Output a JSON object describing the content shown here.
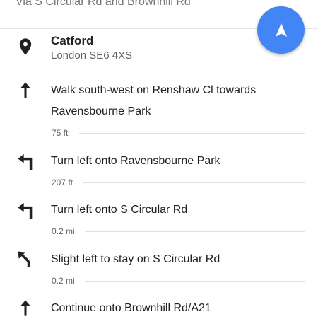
{
  "header": {
    "via_text": "Via S Circular Rd and Brownhill Rd"
  },
  "fab": {
    "icon": "navigation-arrow-icon",
    "color": "#4285f4"
  },
  "destination": {
    "name": "Catford",
    "address": "London SE6 4XS",
    "icon": "location-pin-icon"
  },
  "steps": [
    {
      "icon": "straight-arrow-icon",
      "instruction": "Walk south-west on Renshaw Cl towards Ravensbourne Park",
      "distance": "75 ft"
    },
    {
      "icon": "turn-left-icon",
      "instruction": "Turn left onto Ravensbourne Park",
      "distance": "207 ft"
    },
    {
      "icon": "turn-left-icon",
      "instruction": "Turn left onto S Circular Rd",
      "distance": "0.2 mi"
    },
    {
      "icon": "slight-left-icon",
      "instruction": "Slight left to stay on S Circular Rd",
      "distance": "0.2 mi"
    },
    {
      "icon": "straight-arrow-icon",
      "instruction": "Continue onto Brownhill Rd/A21",
      "distance": ""
    }
  ]
}
